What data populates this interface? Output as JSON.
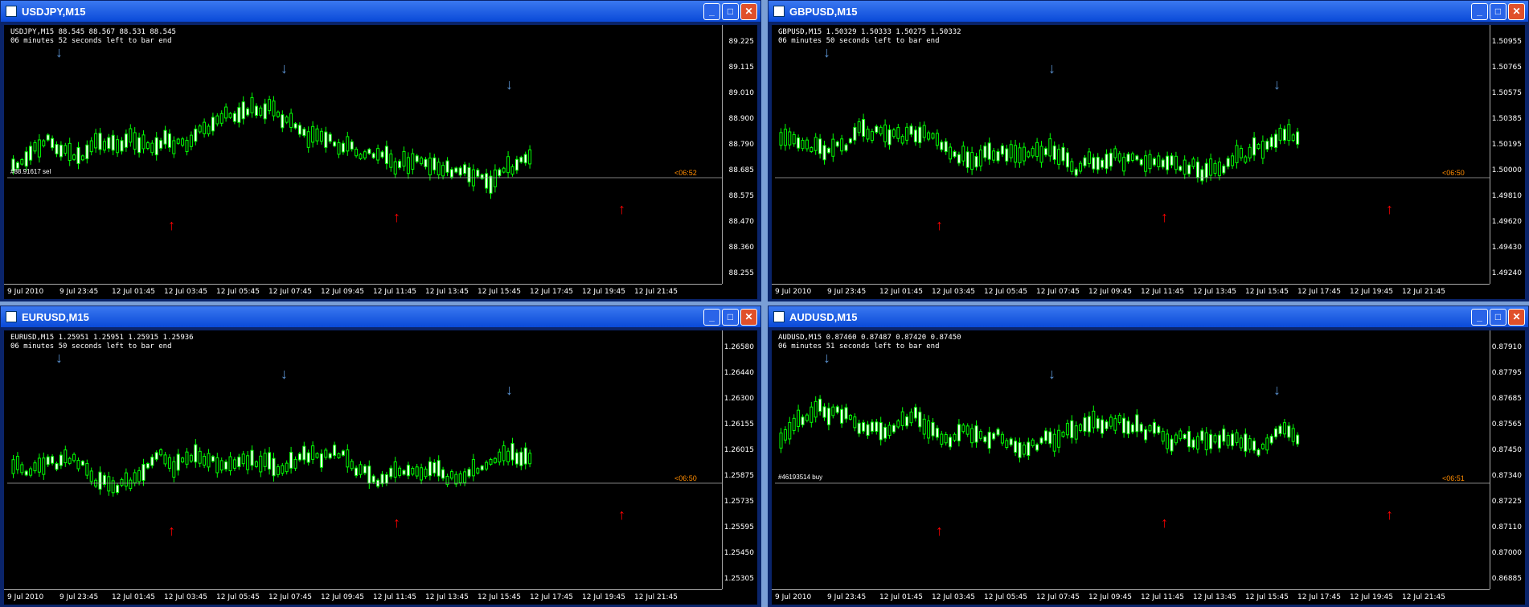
{
  "windows": [
    {
      "title": "USDJPY,M15",
      "info1": "USDJPY,M15  88.545 88.567 88.531 88.545",
      "info2": "06 minutes 52 seconds left to bar end",
      "yticks": [
        "89.225",
        "89.115",
        "89.010",
        "88.900",
        "88.790",
        "88.685",
        "88.575",
        "88.470",
        "88.360",
        "88.255"
      ],
      "price": "88.545",
      "countdown": "<06:52",
      "order": "#88.91617 sel",
      "xticks": [
        "9 Jul 2010",
        "9 Jul 23:45",
        "12 Jul 01:45",
        "12 Jul 03:45",
        "12 Jul 05:45",
        "12 Jul 07:45",
        "12 Jul 09:45",
        "12 Jul 11:45",
        "12 Jul 13:45",
        "12 Jul 15:45",
        "12 Jul 17:45",
        "12 Jul 19:45",
        "12 Jul 21:45"
      ]
    },
    {
      "title": "GBPUSD,M15",
      "info1": "GBPUSD,M15  1.50329 1.50333 1.50275 1.50332",
      "info2": "06 minutes 50 seconds left to bar end",
      "yticks": [
        "1.50955",
        "1.50765",
        "1.50575",
        "1.50385",
        "1.50195",
        "1.50000",
        "1.49810",
        "1.49620",
        "1.49430",
        "1.49240"
      ],
      "price": "1.50332",
      "countdown": "<06:50",
      "order": "",
      "xticks": [
        "9 Jul 2010",
        "9 Jul 23:45",
        "12 Jul 01:45",
        "12 Jul 03:45",
        "12 Jul 05:45",
        "12 Jul 07:45",
        "12 Jul 09:45",
        "12 Jul 11:45",
        "12 Jul 13:45",
        "12 Jul 15:45",
        "12 Jul 17:45",
        "12 Jul 19:45",
        "12 Jul 21:45"
      ]
    },
    {
      "title": "EURUSD,M15",
      "info1": "EURUSD,M15  1.25951 1.25951 1.25915 1.25936",
      "info2": "06 minutes 50 seconds left to bar end",
      "yticks": [
        "1.26580",
        "1.26440",
        "1.26300",
        "1.26155",
        "1.26015",
        "1.25875",
        "1.25735",
        "1.25595",
        "1.25450",
        "1.25305"
      ],
      "price": "1.25936",
      "countdown": "<06:50",
      "order": "",
      "xticks": [
        "9 Jul 2010",
        "9 Jul 23:45",
        "12 Jul 01:45",
        "12 Jul 03:45",
        "12 Jul 05:45",
        "12 Jul 07:45",
        "12 Jul 09:45",
        "12 Jul 11:45",
        "12 Jul 13:45",
        "12 Jul 15:45",
        "12 Jul 17:45",
        "12 Jul 19:45",
        "12 Jul 21:45"
      ]
    },
    {
      "title": "AUDUSD,M15",
      "info1": "AUDUSD,M15  0.87460 0.87487 0.87420 0.87450",
      "info2": "06 minutes 51 seconds left to bar end",
      "yticks": [
        "0.87910",
        "0.87795",
        "0.87685",
        "0.87565",
        "0.87450",
        "0.87340",
        "0.87225",
        "0.87110",
        "0.87000",
        "0.86885"
      ],
      "price": "0.87450",
      "countdown": "<06:51",
      "order": "#46193514 buy",
      "xticks": [
        "9 Jul 2010",
        "9 Jul 23:45",
        "12 Jul 01:45",
        "12 Jul 03:45",
        "12 Jul 05:45",
        "12 Jul 07:45",
        "12 Jul 09:45",
        "12 Jul 11:45",
        "12 Jul 13:45",
        "12 Jul 15:45",
        "12 Jul 17:45",
        "12 Jul 19:45",
        "12 Jul 21:45"
      ]
    }
  ],
  "colors": {
    "bull": "#00ff00",
    "bear": "#ffffff",
    "down": "#5b93d3",
    "up": "#ff0000",
    "price_line": "#aaaaaa",
    "order_line": "#00cc00",
    "countdown": "#ff8c00"
  }
}
